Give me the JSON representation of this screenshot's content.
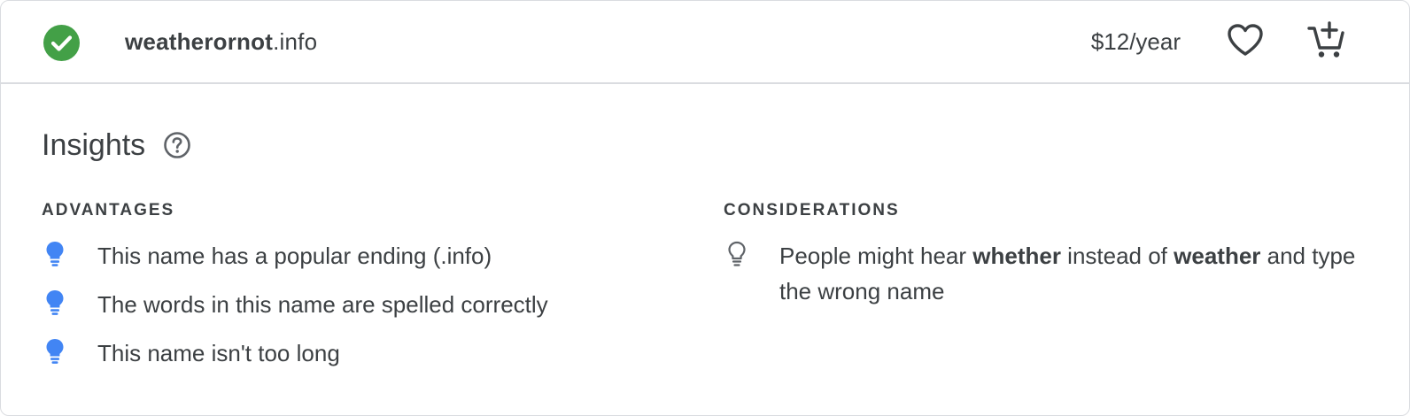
{
  "domain": {
    "sld": "weatherornot",
    "tld": ".info",
    "status_icon": "check-circle-icon",
    "price": "$12/year"
  },
  "actions": {
    "favorite_icon": "heart-outline-icon",
    "cart_icon": "add-shopping-cart-icon"
  },
  "insights": {
    "title": "Insights",
    "help_icon": "help-circle-icon",
    "advantages": {
      "heading": "ADVANTAGES",
      "items": [
        "This name has a popular ending (.info)",
        "The words in this name are spelled correctly",
        "This name isn't too long"
      ]
    },
    "considerations": {
      "heading": "CONSIDERATIONS",
      "items": [
        {
          "text_1": "People might hear ",
          "bold_1": "whether",
          "text_2": " instead of ",
          "bold_2": "weather",
          "text_3": " and type the wrong name"
        }
      ]
    }
  },
  "colors": {
    "available_green": "#43a047",
    "bulb_blue": "#4285f4",
    "text": "#3c4043",
    "divider": "#dadce0"
  }
}
